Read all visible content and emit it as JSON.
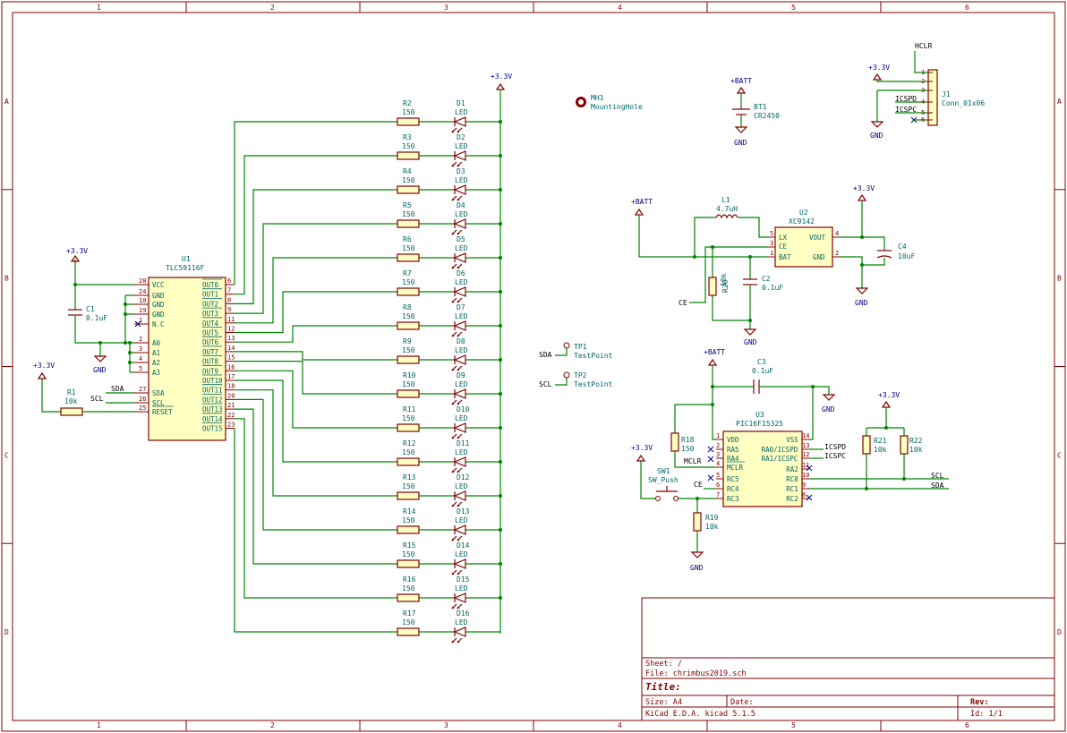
{
  "frame": {
    "cols": [
      "1",
      "2",
      "3",
      "4",
      "5",
      "6"
    ],
    "rows": [
      "A",
      "B",
      "C",
      "D"
    ]
  },
  "title_block": {
    "sheet": "Sheet: /",
    "file": "File: chrimbus2019.sch",
    "title": "Title:",
    "size": "Size: A4",
    "date": "Date:",
    "rev": "Rev:",
    "tool": "KiCad E.D.A.  kicad 5.1.5",
    "id": "Id: 1/1"
  },
  "power": {
    "v33": "+3.3V",
    "batt": "+BATT",
    "gnd": "GND"
  },
  "nets": {
    "sda": "SDA",
    "scl": "SCL",
    "ce": "CE",
    "mclr": "MCLR",
    "hclr": "HCLR",
    "icspd": "ICSPD",
    "icspc": "ICSPC"
  },
  "u1": {
    "ref": "U1",
    "value": "TLC59116F",
    "left_pins": [
      {
        "num": "28",
        "name": "VCC"
      },
      {
        "num": "24",
        "name": "GND"
      },
      {
        "num": "10",
        "name": "GND"
      },
      {
        "num": "19",
        "name": "GND"
      },
      {
        "num": "1",
        "name": "N.C"
      },
      {
        "num": "2",
        "name": "A0"
      },
      {
        "num": "3",
        "name": "A1"
      },
      {
        "num": "4",
        "name": "A2"
      },
      {
        "num": "5",
        "name": "A3"
      },
      {
        "num": "27",
        "name": "SDA"
      },
      {
        "num": "26",
        "name": "SCL"
      },
      {
        "num": "25",
        "name": "RESET"
      }
    ],
    "right_pins": [
      {
        "num": "6",
        "name": "OUT0"
      },
      {
        "num": "7",
        "name": "OUT1"
      },
      {
        "num": "8",
        "name": "OUT2"
      },
      {
        "num": "9",
        "name": "OUT3"
      },
      {
        "num": "11",
        "name": "OUT4"
      },
      {
        "num": "12",
        "name": "OUT5"
      },
      {
        "num": "13",
        "name": "OUT6"
      },
      {
        "num": "14",
        "name": "OUT7"
      },
      {
        "num": "15",
        "name": "OUT8"
      },
      {
        "num": "16",
        "name": "OUT9"
      },
      {
        "num": "17",
        "name": "OUT10"
      },
      {
        "num": "18",
        "name": "OUT11"
      },
      {
        "num": "20",
        "name": "OUT12"
      },
      {
        "num": "21",
        "name": "OUT13"
      },
      {
        "num": "22",
        "name": "OUT14"
      },
      {
        "num": "23",
        "name": "OUT15"
      }
    ]
  },
  "c1": {
    "ref": "C1",
    "value": "0.1uF"
  },
  "r1": {
    "ref": "R1",
    "value": "10k"
  },
  "led_rows": [
    {
      "r": "R2",
      "rv": "150",
      "d": "D1",
      "dv": "LED"
    },
    {
      "r": "R3",
      "rv": "150",
      "d": "D2",
      "dv": "LED"
    },
    {
      "r": "R4",
      "rv": "150",
      "d": "D3",
      "dv": "LED"
    },
    {
      "r": "R5",
      "rv": "150",
      "d": "D4",
      "dv": "LED"
    },
    {
      "r": "R6",
      "rv": "150",
      "d": "D5",
      "dv": "LED"
    },
    {
      "r": "R7",
      "rv": "150",
      "d": "D6",
      "dv": "LED"
    },
    {
      "r": "R8",
      "rv": "150",
      "d": "D7",
      "dv": "LED"
    },
    {
      "r": "R9",
      "rv": "150",
      "d": "D8",
      "dv": "LED"
    },
    {
      "r": "R10",
      "rv": "150",
      "d": "D9",
      "dv": "LED"
    },
    {
      "r": "R11",
      "rv": "150",
      "d": "D10",
      "dv": "LED"
    },
    {
      "r": "R12",
      "rv": "150",
      "d": "D11",
      "dv": "LED"
    },
    {
      "r": "R13",
      "rv": "150",
      "d": "D12",
      "dv": "LED"
    },
    {
      "r": "R14",
      "rv": "150",
      "d": "D13",
      "dv": "LED"
    },
    {
      "r": "R15",
      "rv": "150",
      "d": "D14",
      "dv": "LED"
    },
    {
      "r": "R16",
      "rv": "150",
      "d": "D15",
      "dv": "LED"
    },
    {
      "r": "R17",
      "rv": "150",
      "d": "D16",
      "dv": "LED"
    }
  ],
  "mh1": {
    "ref": "MH1",
    "value": "MountingHole"
  },
  "tp1": {
    "ref": "TP1",
    "value": "TestPoint"
  },
  "tp2": {
    "ref": "TP2",
    "value": "TestPoint"
  },
  "bt1": {
    "ref": "BT1",
    "value": "CR2450"
  },
  "j1": {
    "ref": "J1",
    "value": "Conn_01x06",
    "pins": [
      "1",
      "2",
      "3",
      "4",
      "5",
      "6"
    ]
  },
  "l1": {
    "ref": "L1",
    "value": "4.7uH"
  },
  "u2": {
    "ref": "U2",
    "value": "XC9142",
    "pins": {
      "lx": "LX",
      "ce": "CE",
      "bat": "BAT",
      "vout": "VOUT",
      "gnd": "GND"
    },
    "nums": {
      "lx": "5",
      "ce": "3",
      "bat": "1",
      "vout": "4",
      "gnd": "2"
    }
  },
  "r20": {
    "ref": "R20",
    "value": "10k"
  },
  "c2": {
    "ref": "C2",
    "value": "0.1uF"
  },
  "c4": {
    "ref": "C4",
    "value": "10uF"
  },
  "c3": {
    "ref": "C3",
    "value": "0.1uF"
  },
  "u3": {
    "ref": "U3",
    "value": "PIC16F15325",
    "left_pins": [
      {
        "num": "1",
        "name": "VDD"
      },
      {
        "num": "2",
        "name": "RA5"
      },
      {
        "num": "3",
        "name": "RA4"
      },
      {
        "num": "4",
        "name": "MCLR"
      },
      {
        "num": "5",
        "name": "RC5"
      },
      {
        "num": "6",
        "name": "RC4"
      },
      {
        "num": "7",
        "name": "RC3"
      }
    ],
    "right_pins": [
      {
        "num": "14",
        "name": "VSS"
      },
      {
        "num": "13",
        "name": "RA0/ICSPD"
      },
      {
        "num": "12",
        "name": "RA1/ICSPC"
      },
      {
        "num": "11",
        "name": "RA2"
      },
      {
        "num": "10",
        "name": "RC0"
      },
      {
        "num": "9",
        "name": "RC1"
      },
      {
        "num": "8",
        "name": "RC2"
      }
    ]
  },
  "r18": {
    "ref": "R18",
    "value": "150"
  },
  "r19": {
    "ref": "R19",
    "value": "10k"
  },
  "r21": {
    "ref": "R21",
    "value": "10k"
  },
  "r22": {
    "ref": "R22",
    "value": "10k"
  },
  "sw1": {
    "ref": "SW1",
    "value": "SW_Push"
  }
}
